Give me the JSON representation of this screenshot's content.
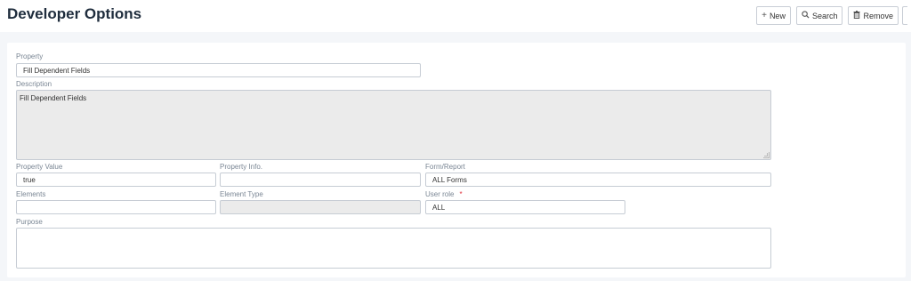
{
  "header": {
    "title": "Developer Options"
  },
  "toolbar": {
    "new": {
      "label": "New",
      "icon": "plus-icon"
    },
    "search": {
      "label": "Search",
      "icon": "search-icon"
    },
    "remove": {
      "label": "Remove",
      "icon": "trash-icon"
    }
  },
  "form": {
    "property": {
      "label": "Property",
      "value": "Fill Dependent Fields"
    },
    "description": {
      "label": "Description",
      "value": "Fill Dependent Fields"
    },
    "property_value": {
      "label": "Property Value",
      "value": "true"
    },
    "property_info": {
      "label": "Property Info.",
      "value": ""
    },
    "form_report": {
      "label": "Form/Report",
      "value": "ALL Forms"
    },
    "elements": {
      "label": "Elements",
      "value": ""
    },
    "element_type": {
      "label": "Element Type",
      "value": ""
    },
    "user_role": {
      "label": "User role",
      "required_mark": "*",
      "value": "ALL"
    },
    "purpose": {
      "label": "Purpose",
      "value": ""
    }
  },
  "colors": {
    "page_background": "#f4f6f9",
    "disabled_field": "#ebebeb",
    "required_mark": "#e0303a"
  }
}
